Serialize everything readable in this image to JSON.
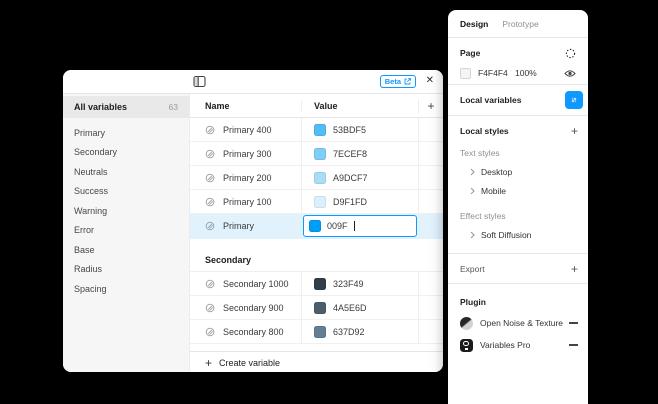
{
  "colors": {
    "accent": "#0D99FF",
    "selection_bg": "#E1F2FD",
    "canvas_bg": "#000000"
  },
  "icons": {
    "close": "✕",
    "plus": "+",
    "sidebar_toggle": "layout-sidebar-icon",
    "external_link": "external-link-icon",
    "variable_token": "variable-token-icon",
    "styles_seed": "dotted-circle-icon",
    "eye": "eye-icon",
    "sliders": "variables-sliders-icon",
    "chevron": "chevron-right-icon",
    "minus": "minus-icon"
  },
  "modal": {
    "beta_badge": "Beta",
    "sidebar": {
      "selected_item": {
        "label": "All variables",
        "count": "63"
      },
      "items": [
        "Primary",
        "Secondary",
        "Neutrals",
        "Success",
        "Warning",
        "Error",
        "Base",
        "Radius",
        "Spacing"
      ]
    },
    "table": {
      "header": {
        "name": "Name",
        "value": "Value",
        "add": "+"
      },
      "rows": [
        {
          "name": "Primary 400",
          "value": "53BDF5",
          "swatch": "#53BDF5"
        },
        {
          "name": "Primary 300",
          "value": "7ECEF8",
          "swatch": "#7ECEF8"
        },
        {
          "name": "Primary 200",
          "value": "A9DCF7",
          "swatch": "#A9DCF7"
        },
        {
          "name": "Primary 100",
          "value": "D9F1FD",
          "swatch": "#D9F1FD"
        }
      ],
      "editing_row": {
        "name": "Primary",
        "value": "009F",
        "swatch": "#009FF5"
      },
      "group_header": "Secondary",
      "rows2": [
        {
          "name": "Secondary 1000",
          "value": "323F49",
          "swatch": "#323F49"
        },
        {
          "name": "Secondary 900",
          "value": "4A5E6D",
          "swatch": "#4A5E6D"
        },
        {
          "name": "Secondary 800",
          "value": "637D92",
          "swatch": "#637D92"
        }
      ],
      "footer": "Create variable"
    }
  },
  "inspector": {
    "tabs": {
      "design": "Design",
      "prototype": "Prototype"
    },
    "page": {
      "label": "Page",
      "hex": "F4F4F4",
      "swatch": "#F4F4F4",
      "opacity": "100%"
    },
    "local_variables_label": "Local variables",
    "local_styles_label": "Local styles",
    "text_styles": {
      "label": "Text styles",
      "items": [
        "Desktop",
        "Mobile"
      ]
    },
    "effect_styles": {
      "label": "Effect styles",
      "items": [
        "Soft Diffusion"
      ]
    },
    "export_label": "Export",
    "plugin": {
      "label": "Plugin",
      "items": [
        "Open Noise & Texture",
        "Variables Pro"
      ]
    }
  }
}
